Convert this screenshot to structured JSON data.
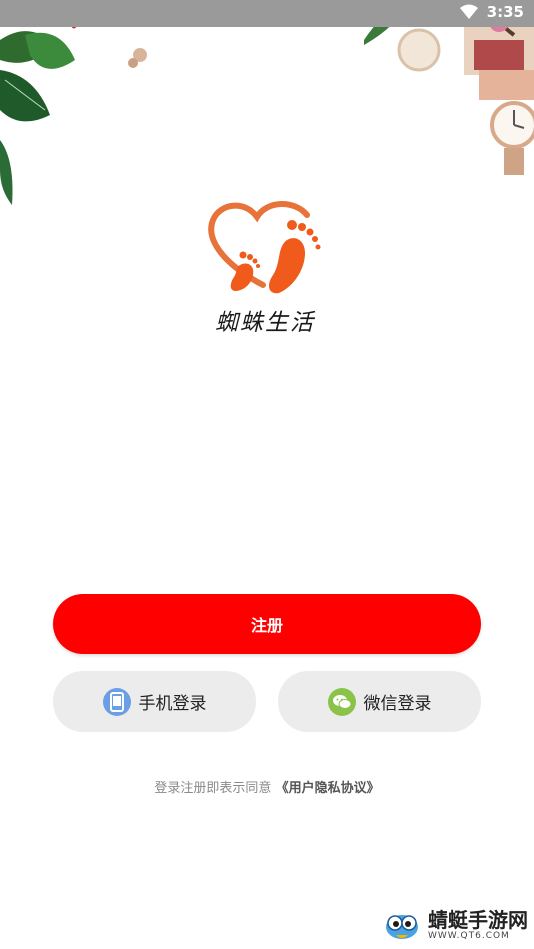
{
  "status_bar": {
    "time": "3:35",
    "wifi_icon": "wifi-icon"
  },
  "logo": {
    "icon": "heart-footprints-logo",
    "text": "蜘蛛生活",
    "colors": {
      "heart": "#e8733a",
      "feet": "#f05a1a"
    }
  },
  "actions": {
    "register_label": "注册",
    "phone_login_label": "手机登录",
    "phone_icon": "phone-icon",
    "wechat_login_label": "微信登录",
    "wechat_icon": "wechat-icon"
  },
  "agreement": {
    "prefix": "登录注册即表示同意",
    "link": "《用户隐私协议》"
  },
  "watermark": {
    "title": "蜻蜓手游网",
    "url": "WWW.QT6.COM"
  },
  "colors": {
    "primary": "#ff0000",
    "secondary_button_bg": "#ececec",
    "phone_icon_bg": "#6a9fe6",
    "wechat_icon_bg": "#8bc34a",
    "status_bar_bg": "#9a9a9a"
  }
}
